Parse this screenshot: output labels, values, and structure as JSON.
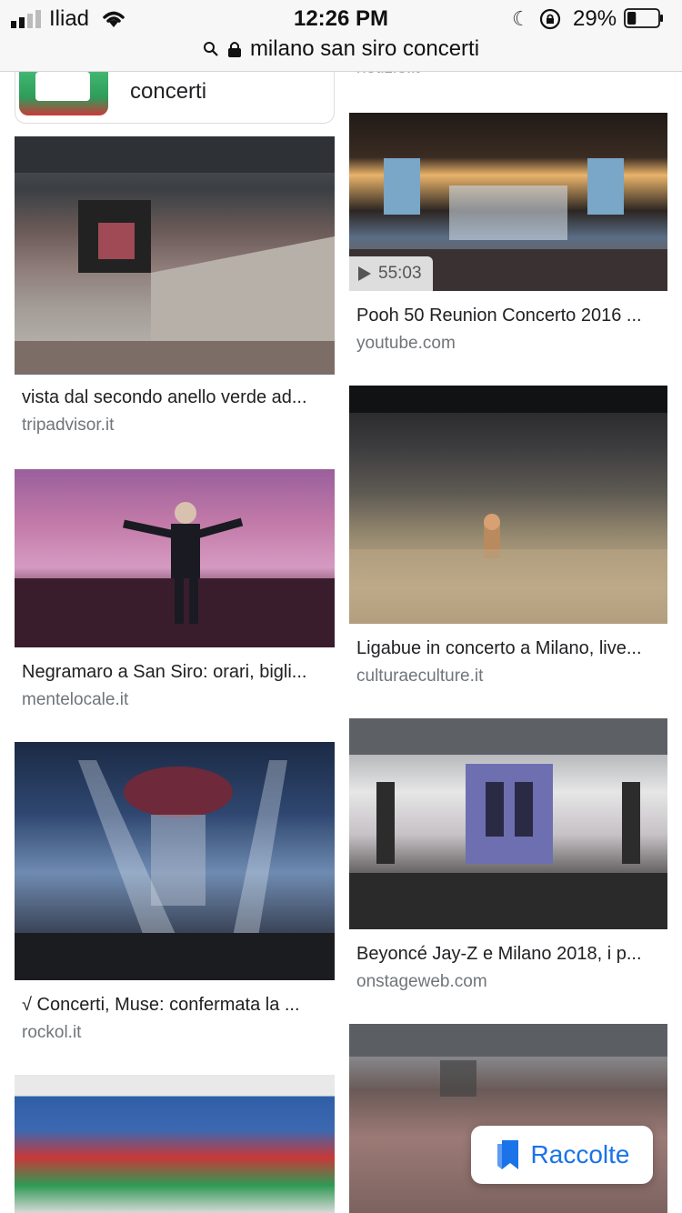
{
  "status_bar": {
    "carrier": "Iliad",
    "time": "12:26 PM",
    "battery_percent": "29%",
    "battery_level": 0.29
  },
  "url_bar": {
    "query": "milano san siro concerti"
  },
  "top_strip": {
    "card_label": "concerti",
    "right_partial_source": "notizie.it"
  },
  "results_left": [
    {
      "title": "vista dal secondo anello verde ad...",
      "source": "tripadvisor.it"
    },
    {
      "title": "Negramaro a San Siro: orari, bigli...",
      "source": "mentelocale.it"
    },
    {
      "title": "√ Concerti, Muse: confermata la ...",
      "source": "rockol.it"
    }
  ],
  "results_right": [
    {
      "title": "Pooh 50 Reunion Concerto 2016 ...",
      "source": "youtube.com",
      "duration": "55:03"
    },
    {
      "title": "Ligabue in concerto a Milano, live...",
      "source": "culturaeculture.it"
    },
    {
      "title": "Beyoncé Jay-Z e Milano 2018, i p...",
      "source": "onstageweb.com"
    }
  ],
  "raccolte_button": {
    "label": "Raccolte"
  },
  "colors": {
    "accent": "#1a73e8",
    "text": "#202124",
    "muted": "#70757a"
  }
}
